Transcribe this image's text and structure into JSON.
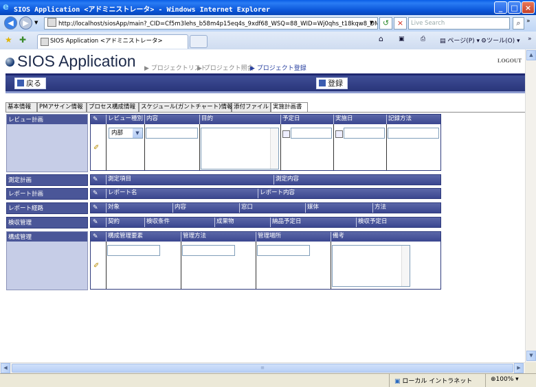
{
  "window": {
    "title": "SIOS Application <アドミニストレータ> - Windows Internet Explorer",
    "minimize": "_",
    "maximize": "□",
    "close": "×"
  },
  "browser": {
    "address": "http://localhost/siosApp/main?_CID=Cf5m3lehs_b58m4p15eq4s_9xdf68_WSQ=88_WID=Wj0qhs_t18kqw8_DMY=1aCf5r",
    "search_placeholder": "Live Search",
    "tab_label": "SIOS Application <アドミニストレータ>",
    "page_menu": "ページ(P)",
    "tools_menu": "ツール(O)"
  },
  "app": {
    "logo": "SIOS Application",
    "breadcrumb": [
      "▶ プロジェクトリスト",
      "▶ プロジェクト照会",
      "▶ プロジェクト登録"
    ],
    "logout": "LOGOUT",
    "back_button": "戻る",
    "register_button": "登録",
    "tabs": [
      "基本情報",
      "PMアサイン情報",
      "プロセス構成情報",
      "スケジュール(ガントチャート)情報",
      "添付ファイル",
      "実施計画書"
    ],
    "active_tab": "実施計画書"
  },
  "sections": {
    "review": {
      "label": "レビュー計画",
      "headers": [
        "レビュー種別",
        "内容",
        "目的",
        "予定日",
        "実施日",
        "記録方法"
      ],
      "type_value": "内部"
    },
    "measurement": {
      "label": "測定計画",
      "headers": [
        "測定項目",
        "測定内容"
      ]
    },
    "report": {
      "label": "レポート計画",
      "headers": [
        "レポート名",
        "レポート内容"
      ]
    },
    "report_route": {
      "label": "レポート経路",
      "headers": [
        "対象",
        "内容",
        "窓口",
        "媒体",
        "方法"
      ]
    },
    "acceptance": {
      "label": "検収管理",
      "headers": [
        "契約",
        "検収条件",
        "成果物",
        "納品予定日",
        "検収予定日"
      ]
    },
    "config": {
      "label": "構成管理",
      "headers": [
        "構成管理要素",
        "管理方法",
        "管理場所",
        "備考"
      ]
    }
  },
  "status": {
    "zone": "ローカル イントラネット",
    "zoom": "100%"
  }
}
